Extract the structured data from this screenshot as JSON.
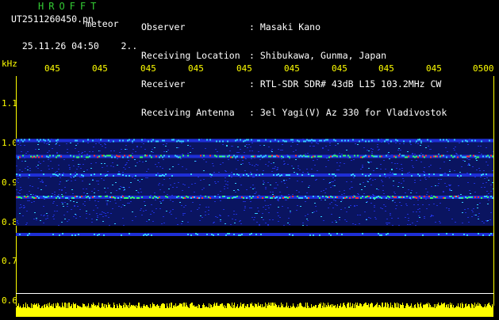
{
  "header": {
    "brand": "HROFFT",
    "filename": "UT2511260450.pn",
    "meteor_label": "meteor",
    "datetime": "25.11.26 04:50",
    "count": "2..",
    "info": [
      {
        "key": "Observer",
        "value": ": Masaki Kano"
      },
      {
        "key": "Receiving Location",
        "value": ": Shibukawa, Gunma, Japan"
      },
      {
        "key": "Receiver",
        "value": ": RTL-SDR SDR# 43dB L15 103.2MHz CW"
      },
      {
        "key": "Receiving Antenna",
        "value": ": 3el Yagi(V) Az 330 for Vladivostok"
      }
    ]
  },
  "axis": {
    "unit": "kHz",
    "freq_labels": [
      "1.1",
      "1.0",
      "0.9",
      "0.8",
      "0.7",
      "0.6"
    ],
    "time_labels": [
      "045",
      "045",
      "045",
      "045",
      "045",
      "045",
      "045",
      "045",
      "045",
      "0500"
    ]
  },
  "colors": {
    "text_green": "#33cc33",
    "text_white": "#ffffff",
    "axis_yellow": "#ffff00",
    "background": "#000000",
    "signal_blue": "#1e2fd6",
    "signal_cyan": "#33ccff",
    "signal_green": "#33ff66",
    "signal_red": "#ff3333",
    "level_yellow": "#ffff00"
  },
  "spectrogram": {
    "bands_khz": [
      1.005,
      0.965,
      0.918,
      0.862,
      0.768
    ],
    "noise_band_khz": [
      0.79,
      1.01
    ]
  }
}
